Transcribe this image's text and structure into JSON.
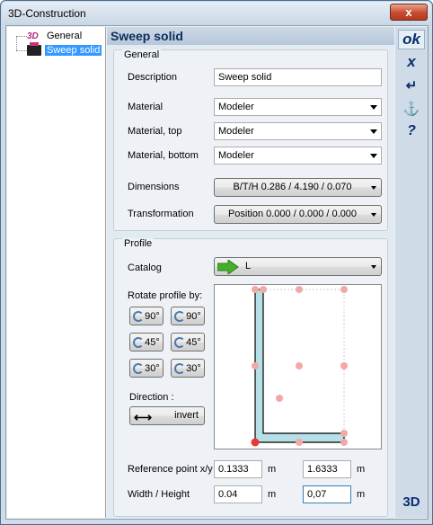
{
  "window": {
    "title": "3D-Construction",
    "close_label": "x"
  },
  "tree": {
    "items": [
      {
        "icon": "3d-icon",
        "icon_text": "3D",
        "label": "General"
      },
      {
        "icon": "solid-icon",
        "label": "Sweep solid"
      }
    ]
  },
  "header": {
    "title": "Sweep solid"
  },
  "general": {
    "title": "General",
    "description_label": "Description",
    "description_value": "Sweep solid",
    "material_label": "Material",
    "material_value": "Modeler",
    "material_top_label": "Material, top",
    "material_top_value": "Modeler",
    "material_bottom_label": "Material, bottom",
    "material_bottom_value": "Modeler",
    "dimensions_label": "Dimensions",
    "dimensions_value": "B/T/H 0.286 / 4.190 / 0.070",
    "transformation_label": "Transformation",
    "transformation_value": "Position 0.000 / 0.000 / 0.000"
  },
  "profile": {
    "title": "Profile",
    "catalog_label": "Catalog",
    "catalog_value": "L",
    "rotate_label": "Rotate profile by:",
    "rotate_buttons": [
      "90°",
      "90°",
      "45°",
      "45°",
      "30°",
      "30°"
    ],
    "direction_label": "Direction :",
    "invert_label": "invert",
    "refpoint_label": "Reference point x/y",
    "refpoint_x": "0.1333",
    "refpoint_y": "1.6333",
    "wh_label": "Width / Height",
    "width": "0.04",
    "height": "0,07",
    "unit": "m"
  },
  "sidebar": {
    "ok_label": "ok",
    "cancel_label": "x",
    "enter_label": "↵",
    "anchor_label": "⚓",
    "help_label": "?",
    "view3d_label": "3D"
  },
  "colors": {
    "accent": "#0b2e6f",
    "selection": "#3399ff",
    "profile_fill": "#b6dfe6",
    "point": "#f1a9a5",
    "point_active": "#e53935",
    "catalog_arrow": "#43b02a"
  }
}
